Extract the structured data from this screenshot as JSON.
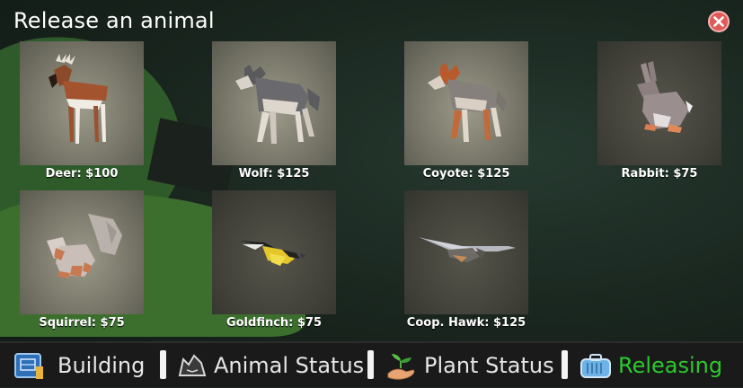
{
  "dialog": {
    "title": "Release an animal"
  },
  "animals": [
    {
      "label": "Deer: $100"
    },
    {
      "label": "Wolf: $125"
    },
    {
      "label": "Coyote: $125"
    },
    {
      "label": "Rabbit: $75"
    },
    {
      "label": "Squirrel: $75"
    },
    {
      "label": "Goldfinch: $75"
    },
    {
      "label": "Coop. Hawk: $125"
    }
  ],
  "tabs": [
    {
      "label": "Building",
      "icon": "building-blueprint-icon"
    },
    {
      "label": "Animal Status",
      "icon": "wolf-head-icon"
    },
    {
      "label": "Plant Status",
      "icon": "seedling-hand-icon"
    },
    {
      "label": "Releasing",
      "icon": "animal-carrier-icon"
    }
  ],
  "colors": {
    "active_tab": "#2cc92c",
    "close_button": "#e15a5a"
  }
}
